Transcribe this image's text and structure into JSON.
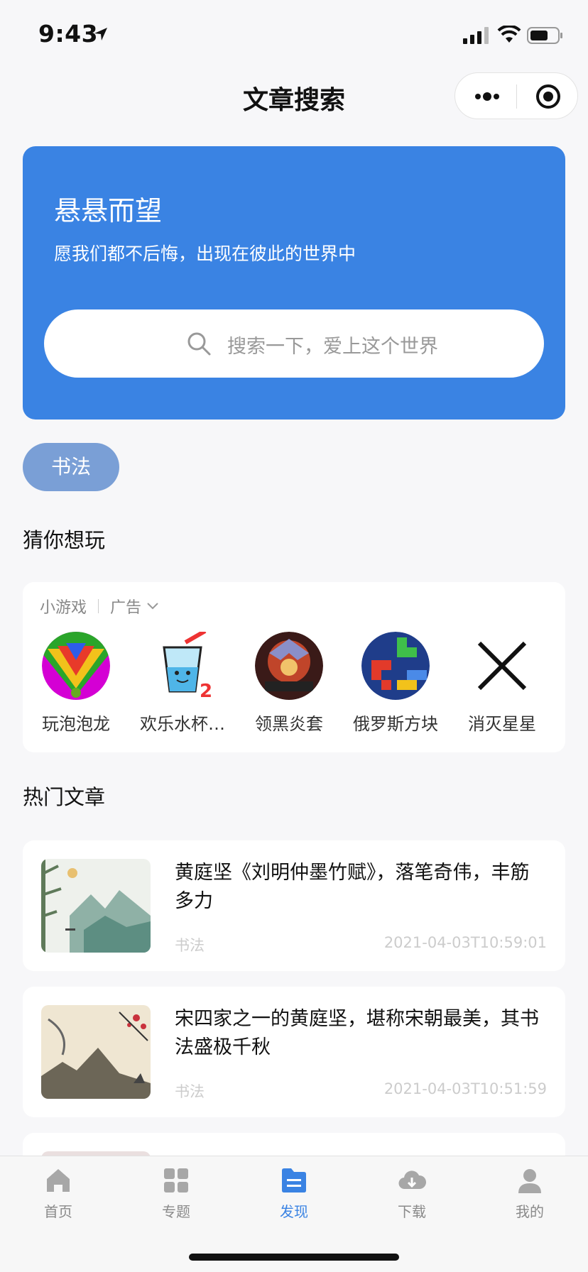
{
  "status": {
    "time": "9:43"
  },
  "nav": {
    "title": "文章搜索"
  },
  "hero": {
    "title": "悬悬而望",
    "subtitle": "愿我们都不后悔，出现在彼此的世界中",
    "search_placeholder": "搜索一下，爱上这个世界"
  },
  "tag": "书法",
  "guess": {
    "title": "猜你想玩",
    "head_label": "小游戏",
    "ad_label": "广告",
    "games": [
      {
        "name": "玩泡泡龙"
      },
      {
        "name": "欢乐水杯…"
      },
      {
        "name": "领黑炎套"
      },
      {
        "name": "俄罗斯方块"
      },
      {
        "name": "消灭星星"
      }
    ]
  },
  "hot": {
    "title": "热门文章",
    "articles": [
      {
        "title": "黄庭坚《刘明仲墨竹赋》，落笔奇伟，丰筋多力",
        "category": "书法",
        "date": "2021-04-03T10:59:01"
      },
      {
        "title": "宋四家之一的黄庭坚，堪称宋朝最美，其书法盛极千秋",
        "category": "书法",
        "date": "2021-04-03T10:51:59"
      }
    ]
  },
  "tabs": [
    {
      "label": "首页",
      "icon": "home-icon"
    },
    {
      "label": "专题",
      "icon": "grid-icon"
    },
    {
      "label": "发现",
      "icon": "discover-icon"
    },
    {
      "label": "下载",
      "icon": "cloud-download-icon"
    },
    {
      "label": "我的",
      "icon": "user-icon"
    }
  ],
  "colors": {
    "primary": "#3a83e3",
    "tag": "#7a9fd6",
    "background": "#f7f7f9"
  }
}
